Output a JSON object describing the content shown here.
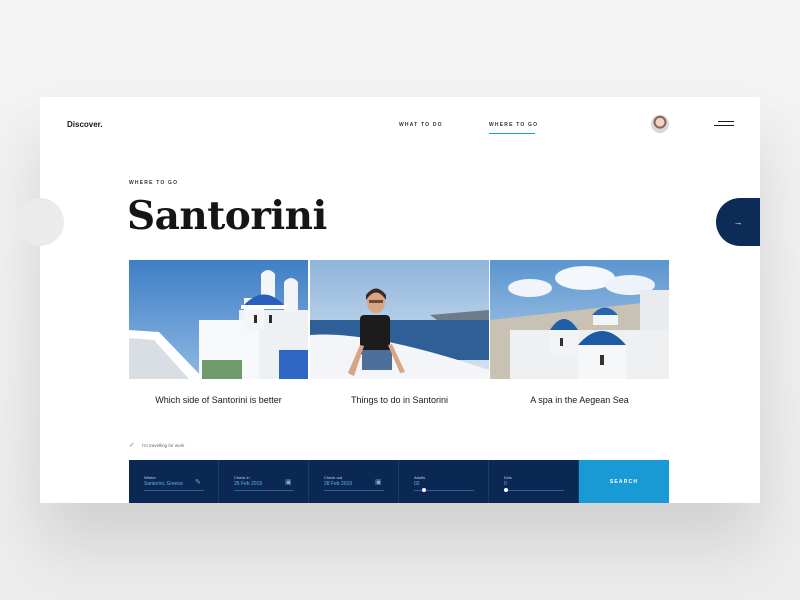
{
  "brand": {
    "logo": "Discover."
  },
  "nav": {
    "items": [
      {
        "label": "WHAT TO DO"
      },
      {
        "label": "WHERE TO GO"
      }
    ],
    "active": "WHERE TO GO",
    "menu_icon": "hamburger-icon"
  },
  "hero": {
    "eyebrow": "WHERE TO GO",
    "title": "Santorini"
  },
  "articles": [
    {
      "caption": "Which side of Santorini is better"
    },
    {
      "caption": "Things to do in Santorini"
    },
    {
      "caption": "A spa in the Aegean Sea"
    }
  ],
  "carousel": {
    "next_icon": "arrow-right-icon",
    "prev_icon": "arrow-left-icon"
  },
  "search": {
    "work_checkbox": {
      "label": "I'm travelling for work",
      "checked": true
    },
    "fields": [
      {
        "label": "Where",
        "value": "Santorini, Greece",
        "icon": "pencil-icon"
      },
      {
        "label": "Check in",
        "value": "25 Feb 2019",
        "icon": "calendar-icon"
      },
      {
        "label": "Check out",
        "value": "28 Feb 2019",
        "icon": "calendar-icon"
      },
      {
        "label": "Adults",
        "value": "02"
      },
      {
        "label": "Kids",
        "value": "0"
      }
    ],
    "button_label": "SEARCH"
  },
  "colors": {
    "accent": "#1a9ad4",
    "navy": "#0b2754",
    "text": "#151515"
  }
}
